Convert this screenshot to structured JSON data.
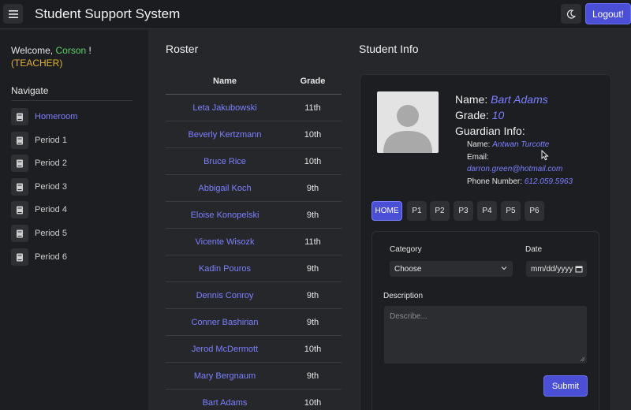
{
  "app": {
    "title": "Student Support System",
    "logout_label": "Logout!"
  },
  "sidebar": {
    "welcome_prefix": "Welcome,",
    "user_name": "Corson",
    "welcome_suffix": "!",
    "role": "(TEACHER)",
    "nav_title": "Navigate",
    "items": [
      {
        "label": "Homeroom",
        "active": true
      },
      {
        "label": "Period 1"
      },
      {
        "label": "Period 2"
      },
      {
        "label": "Period 3"
      },
      {
        "label": "Period 4"
      },
      {
        "label": "Period 5"
      },
      {
        "label": "Period 6"
      }
    ]
  },
  "roster": {
    "title": "Roster",
    "columns": [
      "Name",
      "Grade"
    ],
    "rows": [
      {
        "name": "Leta Jakubowski",
        "grade": "11th"
      },
      {
        "name": "Beverly Kertzmann",
        "grade": "10th"
      },
      {
        "name": "Bruce Rice",
        "grade": "10th"
      },
      {
        "name": "Abbigail Koch",
        "grade": "9th"
      },
      {
        "name": "Eloise Konopelski",
        "grade": "9th"
      },
      {
        "name": "Vicente Wisozk",
        "grade": "11th"
      },
      {
        "name": "Kadin Pouros",
        "grade": "9th"
      },
      {
        "name": "Dennis Conroy",
        "grade": "9th"
      },
      {
        "name": "Conner Bashirian",
        "grade": "9th"
      },
      {
        "name": "Jerod McDermott",
        "grade": "10th"
      },
      {
        "name": "Mary Bergnaum",
        "grade": "9th"
      },
      {
        "name": "Bart Adams",
        "grade": "10th"
      }
    ]
  },
  "student_info": {
    "title": "Student Info",
    "name_label": "Name:",
    "name_value": "Bart Adams",
    "grade_label": "Grade:",
    "grade_value": "10",
    "guardian_label": "Guardian Info:",
    "guardian_name_label": "Name:",
    "guardian_name_value": "Antwan Turcotte",
    "email_label": "Email:",
    "email_value": "darron.green@hotmail.com",
    "phone_label": "Phone Number:",
    "phone_value": "612.059.5963"
  },
  "tabs": [
    {
      "label": "HOME",
      "active": true
    },
    {
      "label": "P1"
    },
    {
      "label": "P2"
    },
    {
      "label": "P3"
    },
    {
      "label": "P4"
    },
    {
      "label": "P5"
    },
    {
      "label": "P6"
    }
  ],
  "form": {
    "category_label": "Category",
    "category_value": "Choose",
    "date_label": "Date",
    "date_placeholder": "mm/dd/yyyy",
    "description_label": "Description",
    "description_placeholder": "Describe...",
    "submit_label": "Submit"
  },
  "colors": {
    "accent": "#4a4fd6",
    "link": "#7b80ff",
    "name_green": "#5fd06a",
    "role_gold": "#e0b23a"
  }
}
